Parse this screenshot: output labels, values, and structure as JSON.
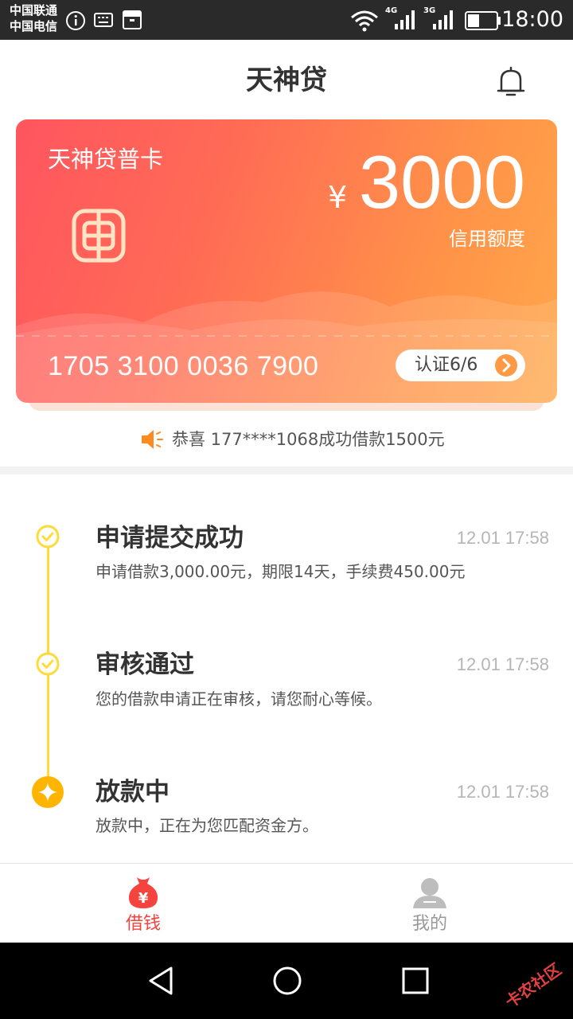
{
  "status_bar": {
    "carrier_1": "中国联通",
    "carrier_2": "中国电信",
    "network_1": "4G",
    "network_2": "3G",
    "time": "18:00"
  },
  "header": {
    "title": "天神贷"
  },
  "card": {
    "name": "天神贷普卡",
    "currency": "¥",
    "amount": "3000",
    "amount_label": "信用额度",
    "number": "1705 3100 0036 7900",
    "auth_label": "认证6/6"
  },
  "notice": {
    "text": "恭喜 177****1068成功借款1500元"
  },
  "timeline": [
    {
      "title": "申请提交成功",
      "time": "12.01 17:58",
      "desc": "申请借款3,000.00元，期限14天，手续费450.00元",
      "state": "done"
    },
    {
      "title": "审核通过",
      "time": "12.01 17:58",
      "desc": "您的借款申请正在审核，请您耐心等候。",
      "state": "done"
    },
    {
      "title": "放款中",
      "time": "12.01 17:58",
      "desc": "放款中，正在为您匹配资金方。",
      "state": "current"
    }
  ],
  "nav": {
    "items": [
      {
        "label": "借钱",
        "active": true
      },
      {
        "label": "我的",
        "active": false
      }
    ]
  },
  "watermark": "卡农社区",
  "colors": {
    "accent_red": "#f5433e",
    "card_start": "#ff555f",
    "card_end": "#ffa84c",
    "timeline_yellow": "#fddc3a",
    "current_dot": "#ffb400"
  }
}
